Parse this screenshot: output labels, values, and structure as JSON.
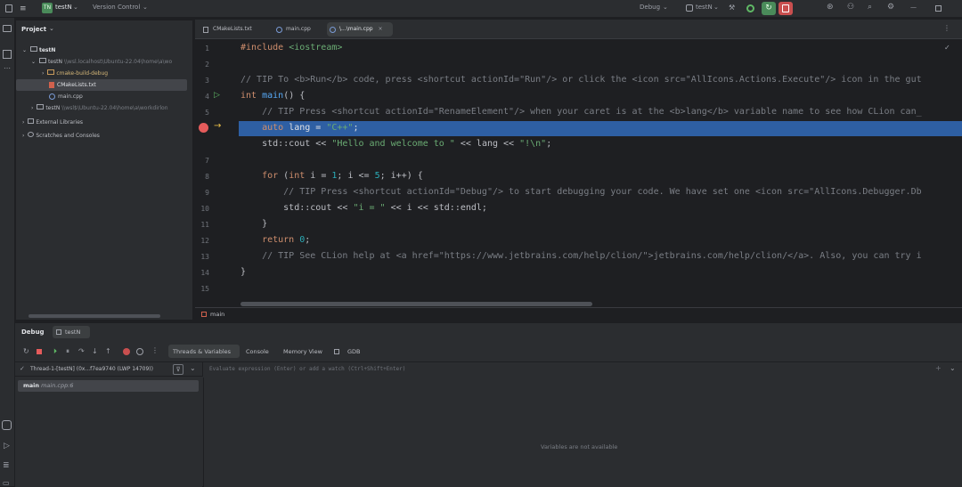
{
  "titlebar": {
    "project_badge": "TN",
    "project_name": "testN",
    "vcs_label": "Version Control",
    "run_config": "Debug",
    "target": "testN"
  },
  "project_panel": {
    "title": "Project",
    "tree": [
      {
        "label": "testN",
        "path": ""
      },
      {
        "label": "testN",
        "path": "\\\\wsl.localhost\\Ubuntu-22.04\\home\\a\\wo"
      },
      {
        "label": "cmake-build-debug",
        "path": ""
      },
      {
        "label": "CMakeLists.txt",
        "path": ""
      },
      {
        "label": "main.cpp",
        "path": ""
      },
      {
        "label": "testN",
        "path": "\\\\wsl$\\Ubuntu-22.04\\home\\a\\workdirlon"
      },
      {
        "label": "External Libraries",
        "path": ""
      },
      {
        "label": "Scratches and Consoles",
        "path": ""
      }
    ]
  },
  "editor": {
    "tabs": [
      "CMakeLists.txt",
      "main.cpp",
      "\\...\\main.cpp"
    ],
    "breadcrumb": "main",
    "code": {
      "l1a": "#include ",
      "l1b": "<iostream>",
      "l3": "// TIP To <b>Run</b> code, press <shortcut actionId=\"Run\"/> or click the <icon src=\"AllIcons.Actions.Execute\"/> icon in the gut",
      "l4a": "int ",
      "l4b": "main",
      "l4c": "() {",
      "l5": "    // TIP Press <shortcut actionId=\"RenameElement\"/> when your caret is at the <b>lang</b> variable name to see how CLion can_",
      "l6a": "    auto ",
      "l6b": "lang = ",
      "l6c": "\"C++\"",
      "l6d": ";",
      "l7a": "    std::cout << ",
      "l7b": "\"Hello and welcome to \"",
      "l7c": " << lang << ",
      "l7d": "\"!\\n\"",
      "l7e": ";",
      "l9a": "    for ",
      "l9b": "(",
      "l9c": "int ",
      "l9d": "i = ",
      "l9e": "1",
      "l9f": "; i <= ",
      "l9g": "5",
      "l9h": "; i++) {",
      "l10": "        // TIP Press <shortcut actionId=\"Debug\"/> to start debugging your code. We have set one <icon src=\"AllIcons.Debugger.Db",
      "l11a": "        std::cout << ",
      "l11b": "\"i = \"",
      "l11c": " << i << std::endl;",
      "l12": "    }",
      "l13a": "    return ",
      "l13b": "0",
      "l13c": ";",
      "l14": "    // TIP See CLion help at <a href=\"https://www.jetbrains.com/help/clion/\">jetbrains.com/help/clion/</a>. Also, you can try i",
      "l15": "}"
    }
  },
  "debug_panel": {
    "title": "Debug",
    "session_tab": "testN",
    "tabs": [
      "Threads & Variables",
      "Console",
      "Memory View",
      "GDB"
    ],
    "thread": "Thread-1-[testN] (0x...f7ea9740 (LWP 14709))",
    "eval_placeholder": "Evaluate expression (Enter) or add a watch (Ctrl+Shift+Enter)",
    "frame_fn": "main",
    "frame_file": "main.cpp:6",
    "vars_empty": "Variables are not available"
  }
}
